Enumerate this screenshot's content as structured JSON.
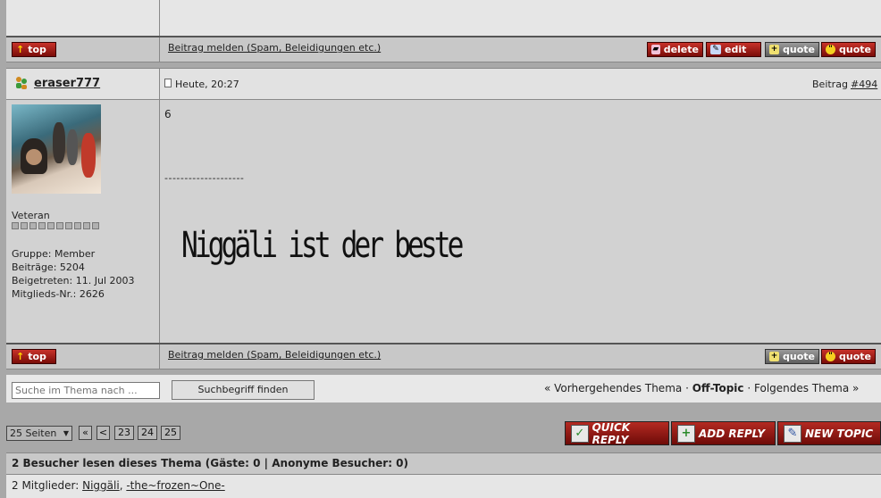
{
  "post_actions": {
    "top_label": "top",
    "report_link": "Beitrag melden (Spam, Beleidigungen etc.)",
    "delete_label": "delete",
    "edit_label": "edit",
    "quote_plus_label": "quote",
    "quote_label": "quote"
  },
  "post": {
    "author": "eraser777",
    "date": "Heute, 20:27",
    "post_label": "Beitrag",
    "post_number": "#494",
    "body_text": "6",
    "signature_line": "--------------------",
    "signature_text": "Niggäli ist der beste"
  },
  "author_info": {
    "rank": "Veteran",
    "group": "Gruppe: Member",
    "posts": "Beiträge: 5204",
    "joined": "Beigetreten: 11. Jul 2003",
    "member_no": "Mitglieds-Nr.: 2626",
    "rank_pips": 10
  },
  "search": {
    "placeholder": "Suche im Thema nach ...",
    "button": "Suchbegriff finden"
  },
  "topic_nav": {
    "prev": "« Vorhergehendes Thema",
    "sep1": "·",
    "current": "Off-Topic",
    "sep2": "·",
    "next": "Folgendes Thema »"
  },
  "pagination": {
    "pages_select": "25 Seiten",
    "first": "«",
    "prev": "<",
    "pages": [
      "23",
      "24",
      "25"
    ]
  },
  "buttons": {
    "quick_reply": "QUICK REPLY",
    "add_reply": "ADD REPLY",
    "new_topic": "NEW TOPIC"
  },
  "visitors": {
    "heading": "2 Besucher lesen dieses Thema (Gäste: 0 | Anonyme Besucher: 0)",
    "members_label": "2 Mitglieder:",
    "members": [
      "Niggäli",
      "-the~frozen~One-"
    ]
  },
  "colors": {
    "button_red": "#a01a14",
    "button_gray": "#7a7a7a",
    "page_bg": "#a8a8a8"
  }
}
